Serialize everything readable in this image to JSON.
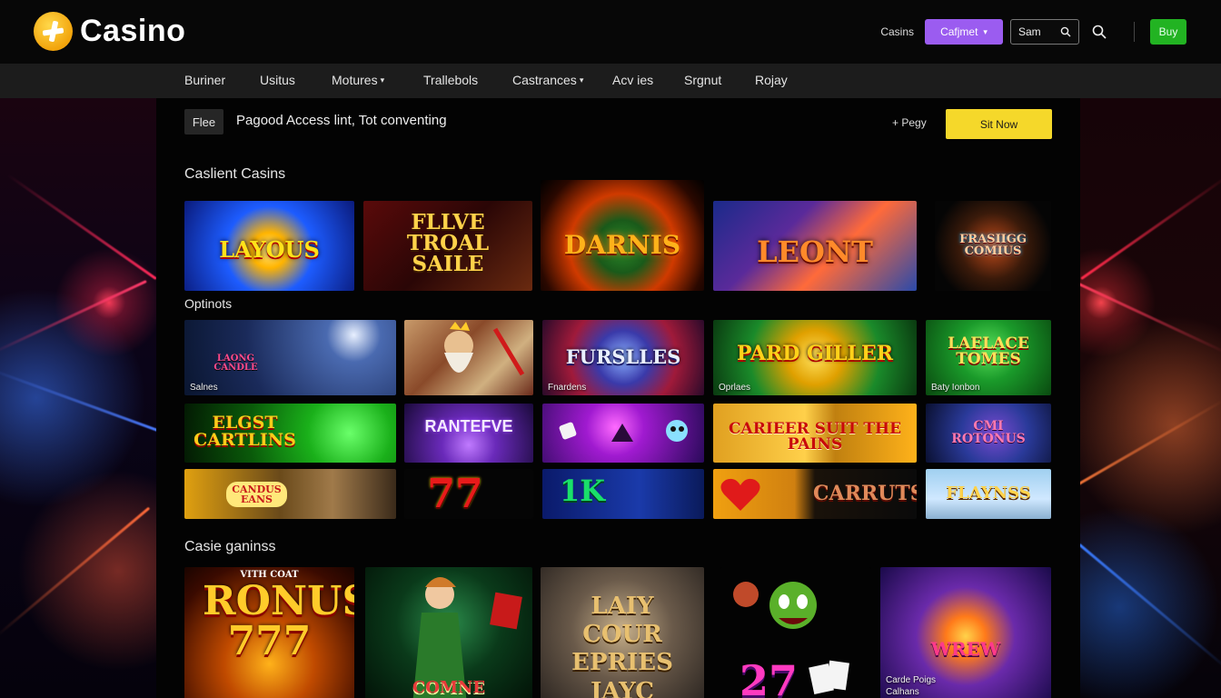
{
  "brand": {
    "name": "Casino"
  },
  "header": {
    "link": "Casins",
    "select_label": "Cafjmet",
    "search_value": "Sam",
    "buy_label": "Buy"
  },
  "nav": {
    "items": [
      {
        "label": "Buriner",
        "has_caret": false
      },
      {
        "label": "Usitus",
        "has_caret": false
      },
      {
        "label": "Motures",
        "has_caret": true
      },
      {
        "label": "Trallebols",
        "has_caret": false
      },
      {
        "label": "Castrances",
        "has_caret": true
      },
      {
        "label": "Acv ies",
        "has_caret": false
      },
      {
        "label": "Srgnut",
        "has_caret": false
      },
      {
        "label": "Rojay",
        "has_caret": false
      }
    ]
  },
  "promo": {
    "tag": "Flee",
    "text": "Pagood Access lint, Tot conventing",
    "link": "+ Pegy",
    "button": "Sit Now"
  },
  "sections": {
    "featured_title": "Caslient Casins",
    "options_title": "Optinots",
    "games_title": "Casie ganinss"
  },
  "featured_games": [
    {
      "title": "LAYOUS"
    },
    {
      "title": "FLLVE TROAL SAILE"
    },
    {
      "title": "DARNIS"
    },
    {
      "title": "LEONT"
    },
    {
      "title": "FRASIIGG COMIUS"
    }
  ],
  "option_games_row1": [
    {
      "title": "LAONG CANDLE",
      "caption": "Salnes"
    },
    {
      "title": "",
      "caption": ""
    },
    {
      "title": "FURSLLES",
      "caption": "Fnardens"
    },
    {
      "title": "PARD GILLER",
      "caption": "Oprlaes"
    },
    {
      "title": "LAELACE TOMES",
      "caption": "Baty Ionbon"
    }
  ],
  "option_games_row2": [
    {
      "title": "ELGST CARTLINS"
    },
    {
      "title": "RANTEFVE"
    },
    {
      "title": ""
    },
    {
      "title": "CARIEER  SUIT THE PAINS"
    },
    {
      "title": "CMI ROTONUS"
    }
  ],
  "option_games_row3": [
    {
      "title": "CANDUS EANS"
    },
    {
      "title": "77"
    },
    {
      "title": "1K"
    },
    {
      "title": "CARRUTS"
    },
    {
      "title": "FLAYNSS"
    }
  ],
  "casino_games": [
    {
      "title": "RONUS 777",
      "top": "VITH COAT"
    },
    {
      "title": "COMNE"
    },
    {
      "title": "LAIY COUR EPRIES JAYC"
    },
    {
      "title": "27"
    },
    {
      "title": "WREW",
      "caption": "Carde Poigs Calhans"
    }
  ]
}
